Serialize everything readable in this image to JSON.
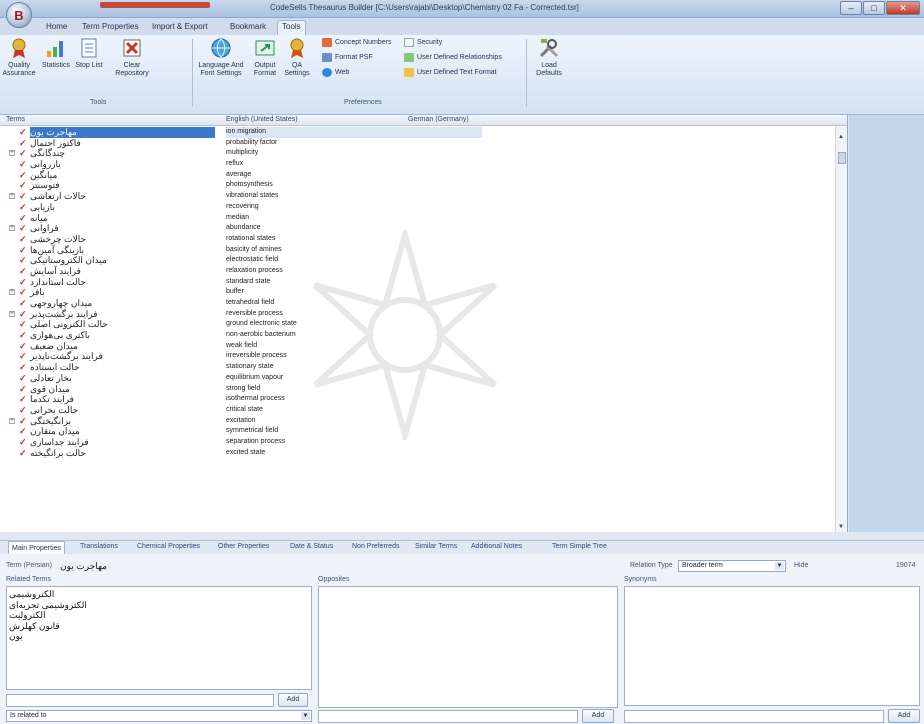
{
  "window": {
    "app_logo_letter": "B",
    "title": "CodeSells Thesaurus Builder [C:\\Users\\rajabi\\Desktop\\Chemistry 02 Fa - Corrected.tsr]",
    "buttons": [
      "‒",
      "□",
      "✕"
    ]
  },
  "ribbon_tabs": [
    {
      "label": "Home",
      "active": false
    },
    {
      "label": "Term Properties",
      "active": false
    },
    {
      "label": "Import & Export",
      "active": false
    },
    {
      "label": "Bookmark",
      "active": false
    },
    {
      "label": "Tools",
      "active": true
    }
  ],
  "ribbon": {
    "tools_group": {
      "label": "Tools",
      "buttons": [
        {
          "label": "Quality\nAssurance",
          "icon": "award-ribbon-icon"
        },
        {
          "label": "Statistics",
          "icon": "bar-chart-icon"
        },
        {
          "label": "Stop List",
          "icon": "document-list-icon"
        },
        {
          "label": "Clear\nRepository",
          "icon": "clear-x-icon"
        }
      ]
    },
    "preferences_group": {
      "label": "Preferences",
      "buttons": [
        {
          "label": "Language And\nFont Settings",
          "icon": "globe-icon"
        },
        {
          "label": "Output\nFormat",
          "icon": "output-icon"
        },
        {
          "label": "QA\nSettings",
          "icon": "qa-ribbon-icon"
        }
      ],
      "small_buttons": [
        {
          "label": "Concept Numbers",
          "icon": "numbers-icon"
        },
        {
          "label": "Format PSF",
          "icon": "format-icon"
        },
        {
          "label": "Web",
          "icon": "web-icon"
        },
        {
          "label": "Security",
          "icon": "lock-icon"
        },
        {
          "label": "User Defined Relationships",
          "icon": "relationships-icon"
        },
        {
          "label": "User Defined Text Format",
          "icon": "text-format-icon"
        }
      ]
    },
    "load_defaults": {
      "label": "Load\nDefaults",
      "icon": "tools-icon"
    }
  },
  "grid": {
    "columns": [
      "Terms",
      "English (United States)",
      "German (Germany)"
    ],
    "rows": [
      {
        "fa": "مهاجرت یون",
        "en": "ion migration",
        "selected": true,
        "expandable": false
      },
      {
        "fa": "فاکتور احتمال",
        "en": "probability factor",
        "selected": false,
        "expandable": false
      },
      {
        "fa": "چندگانگی",
        "en": "multiplicity",
        "selected": false,
        "expandable": true
      },
      {
        "fa": "بازروانی",
        "en": "reflux",
        "selected": false,
        "expandable": false
      },
      {
        "fa": "میانگین",
        "en": "average",
        "selected": false,
        "expandable": false
      },
      {
        "fa": "فتوسنتز",
        "en": "photosynthesis",
        "selected": false,
        "expandable": false
      },
      {
        "fa": "حالات ارتعاشی",
        "en": "vibrational states",
        "selected": false,
        "expandable": true
      },
      {
        "fa": "بازیابی",
        "en": "recovering",
        "selected": false,
        "expandable": false
      },
      {
        "fa": "میانه",
        "en": "median",
        "selected": false,
        "expandable": false
      },
      {
        "fa": "فراوانی",
        "en": "abundance",
        "selected": false,
        "expandable": true
      },
      {
        "fa": "حالات چرخشی",
        "en": "rotational states",
        "selected": false,
        "expandable": false
      },
      {
        "fa": "بازینگی آمین‌ها",
        "en": "basicity of amines",
        "selected": false,
        "expandable": false
      },
      {
        "fa": "میدان الکتروستاتیکی",
        "en": "electrostatic field",
        "selected": false,
        "expandable": false
      },
      {
        "fa": "فرایند آسایش",
        "en": "relaxation process",
        "selected": false,
        "expandable": false
      },
      {
        "fa": "حالت استاندارد",
        "en": "standard state",
        "selected": false,
        "expandable": false
      },
      {
        "fa": "بافر",
        "en": "buffer",
        "selected": false,
        "expandable": true
      },
      {
        "fa": "میدان چهاروجهی",
        "en": "tetrahedral field",
        "selected": false,
        "expandable": false
      },
      {
        "fa": "فرایند برگشت‌پذیر",
        "en": "reversible process",
        "selected": false,
        "expandable": true
      },
      {
        "fa": "حالت الکترونی اصلی",
        "en": "ground electronic state",
        "selected": false,
        "expandable": false
      },
      {
        "fa": "باکتری بی‌هوازی",
        "en": "non-aerobic bacterium",
        "selected": false,
        "expandable": false
      },
      {
        "fa": "میدان ضعیف",
        "en": "weak field",
        "selected": false,
        "expandable": false
      },
      {
        "fa": "فرایند برگشت‌ناپذیر",
        "en": "irreversible process",
        "selected": false,
        "expandable": false
      },
      {
        "fa": "حالت ایستاده",
        "en": "stationary state",
        "selected": false,
        "expandable": false
      },
      {
        "fa": "بخار تعادلی",
        "en": "equilibrium vapour",
        "selected": false,
        "expandable": false
      },
      {
        "fa": "میدان قوی",
        "en": "strong field",
        "selected": false,
        "expandable": false
      },
      {
        "fa": "فرایند تکدما",
        "en": "isothermal process",
        "selected": false,
        "expandable": false
      },
      {
        "fa": "حالت بحرانی",
        "en": "critical state",
        "selected": false,
        "expandable": false
      },
      {
        "fa": "برانگیختگی",
        "en": "excitation",
        "selected": false,
        "expandable": true
      },
      {
        "fa": "میدان متقارن",
        "en": "symmetrical field",
        "selected": false,
        "expandable": false
      },
      {
        "fa": "فرایند جداسازی",
        "en": "separation process",
        "selected": false,
        "expandable": false
      },
      {
        "fa": "حالت برانگیخته",
        "en": "excited state",
        "selected": false,
        "expandable": false
      }
    ]
  },
  "bottom_tabs": [
    {
      "label": "Main Properties",
      "active": true
    },
    {
      "label": "Translations",
      "active": false
    },
    {
      "label": "Chemical Properties",
      "active": false
    },
    {
      "label": "Other Properties",
      "active": false
    },
    {
      "label": "Date & Status",
      "active": false
    },
    {
      "label": "Non Preferreds",
      "active": false
    },
    {
      "label": "Similar Terms",
      "active": false
    },
    {
      "label": "Additional Notes",
      "active": false
    },
    {
      "label": "Term Simple Tree",
      "active": false
    }
  ],
  "detail": {
    "term_label": "Term (Persian)",
    "term_value": "مهاجرت یون",
    "relation_type_label": "Relation Type",
    "relation_type_value": "Broader term",
    "hide_label": "Hide",
    "count": "19074",
    "related_terms_label": "Related Terms",
    "related_terms": [
      "الکتروشیمی",
      "الکتروشیمی تجزیه‌ای",
      "الکترولیت",
      "قانون کهلرش",
      "یون"
    ],
    "opposites_label": "Opposites",
    "synonyms_label": "Synonyms",
    "add_label": "Add",
    "relation_select": "Is related to"
  },
  "colors": {
    "accent": "#3a78c8",
    "check": "#d4262c",
    "ribbon": "#d5e2f2"
  }
}
